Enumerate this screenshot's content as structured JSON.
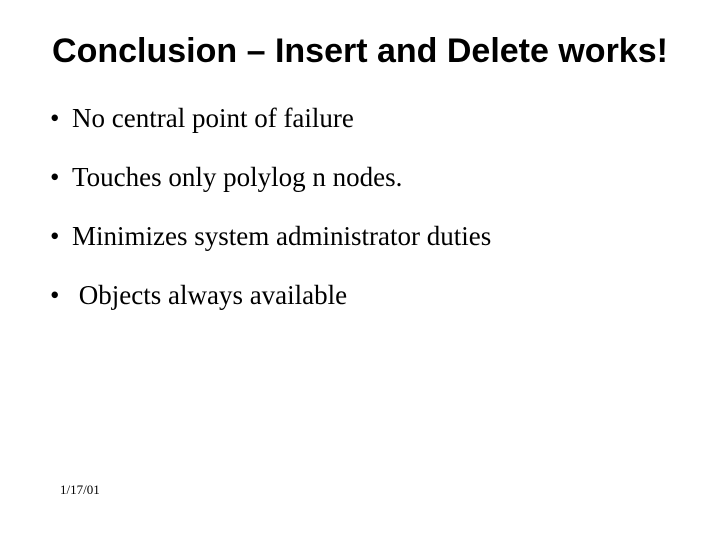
{
  "title": "Conclusion – Insert and Delete works!",
  "bullets": [
    "No central point of failure",
    "Touches only polylog n nodes.",
    "Minimizes system administrator duties",
    " Objects always available"
  ],
  "footer": {
    "date": "1/17/01"
  }
}
